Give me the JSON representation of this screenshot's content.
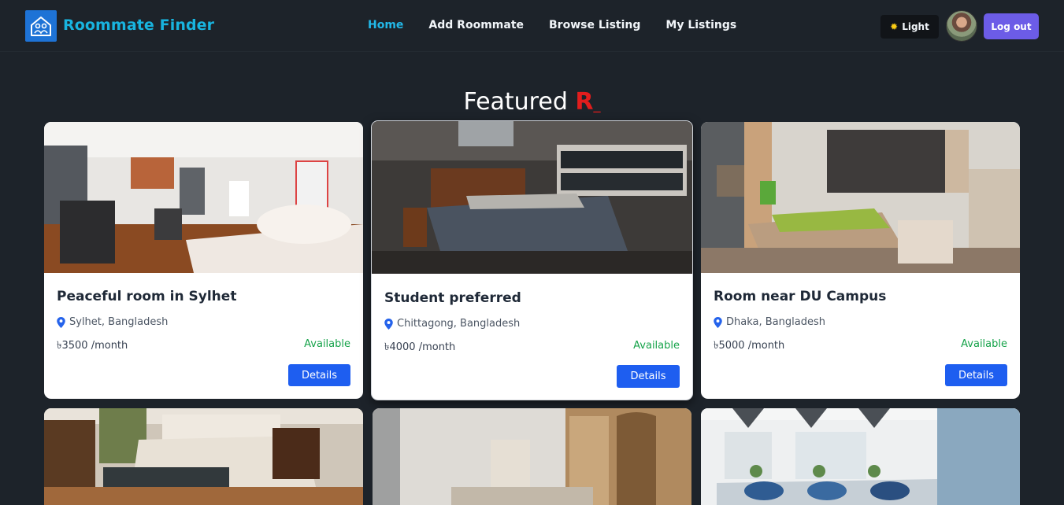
{
  "brand": {
    "name": "Roommate Finder",
    "logo_icon": "home-people-icon"
  },
  "nav": {
    "links": [
      "Home",
      "Add Roommate",
      "Browse Listing",
      "My Listings"
    ],
    "active": "Home"
  },
  "actions": {
    "theme_label": "Light",
    "theme_icon": "sun-icon",
    "logout_label": "Log out"
  },
  "section": {
    "title_prefix": "Featured",
    "title_accent": "R",
    "title_cursor": "_"
  },
  "listings": [
    {
      "title": "Peaceful room in Sylhet",
      "location": "Sylhet, Bangladesh",
      "price": "৳3500 /month",
      "status": "Available",
      "button": "Details"
    },
    {
      "title": "Student preferred",
      "location": "Chittagong, Bangladesh",
      "price": "৳4000 /month",
      "status": "Available",
      "button": "Details"
    },
    {
      "title": "Room near DU Campus",
      "location": "Dhaka, Bangladesh",
      "price": "৳5000 /month",
      "status": "Available",
      "button": "Details"
    }
  ],
  "colors": {
    "background": "#1d232a",
    "brand": "#18b4df",
    "accent": "#e11d1d",
    "logout": "#6c5ce7",
    "status": "#16a34a",
    "button": "#1e5ef0"
  }
}
